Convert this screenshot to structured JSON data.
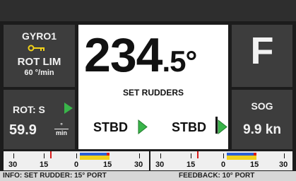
{
  "gyro": {
    "title": "GYRO1",
    "rot_limit_label": "ROT LIM",
    "rot_limit_value": "60 °/min",
    "icon": "key-icon",
    "icon_color": "#f2d21a"
  },
  "rot": {
    "label": "ROT: S",
    "value": "59.9",
    "unit_num": "°",
    "unit_den": "min",
    "arrow_icon": "arrow-right-icon",
    "arrow_color": "#39b54a"
  },
  "heading": {
    "whole": "234",
    "fraction": ".5°"
  },
  "rudder": {
    "title": "SET RUDDERS",
    "left_label": "STBD",
    "right_label": "STBD",
    "arrow_icon": "arrow-right-icon",
    "arrow_color": "#39b54a"
  },
  "mode": {
    "letter": "F"
  },
  "sog": {
    "label": "SOG",
    "value": "9.9 kn"
  },
  "scale_left": {
    "labels": [
      "30",
      "15",
      "0",
      "15",
      "30"
    ]
  },
  "scale_right": {
    "labels": [
      "30",
      "15",
      "0",
      "15",
      "30"
    ]
  },
  "info": {
    "set_rudder": "INFO: SET RUDDER: 15° PORT",
    "feedback": "FEEDBACK: 10° PORT"
  },
  "colors": {
    "panel": "#3d3d3d",
    "background": "#1c1c1c",
    "accent_green": "#39b54a",
    "scale_red": "#d81b1b",
    "scale_blue": "#2a5fd6",
    "scale_yellow": "#f2d21a"
  }
}
